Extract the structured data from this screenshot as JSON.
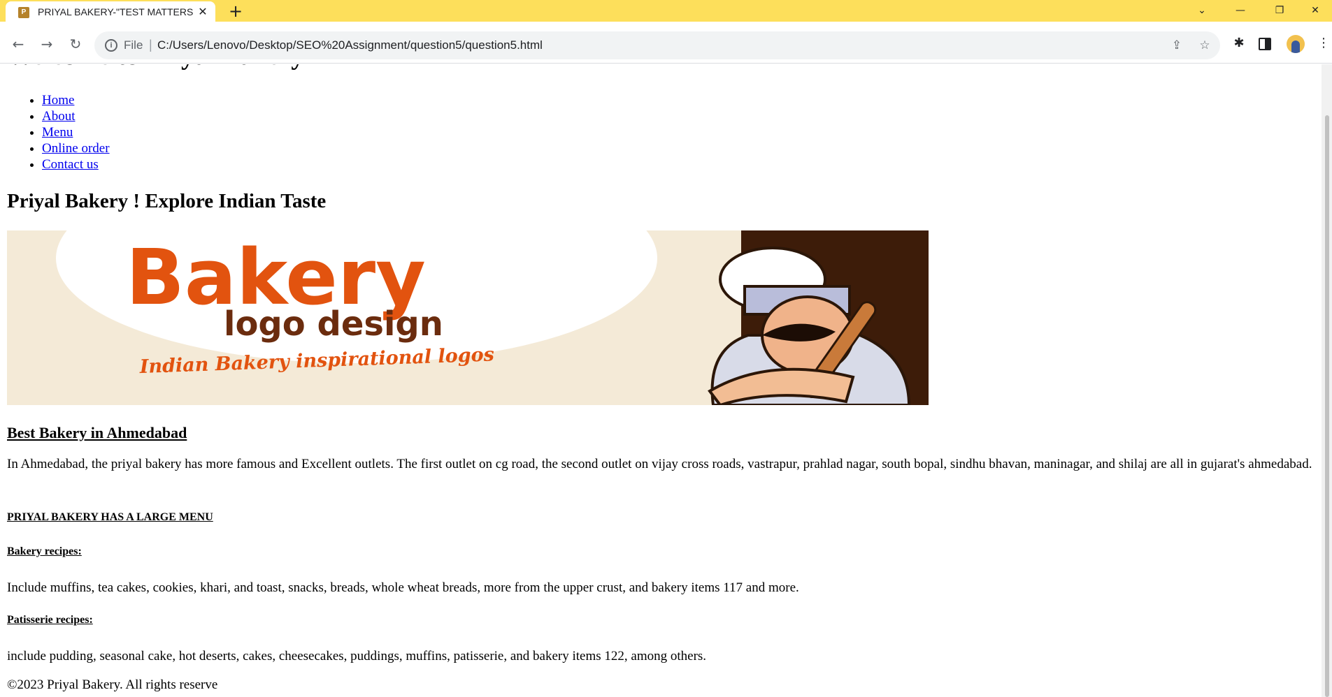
{
  "browser": {
    "tab_title": "PRIYAL BAKERY-\"TEST MATTERS",
    "tab_favicon_letter": "P",
    "url_scheme": "File",
    "url": "C:/Users/Lenovo/Desktop/SEO%20Assignment/question5/question5.html",
    "accent_color": "#fddf5b"
  },
  "page": {
    "title_cut": "Welcome to Priyal Bakery",
    "nav": [
      "Home",
      "About",
      "Menu",
      "Online order",
      "Contact us"
    ],
    "h2": "Priyal Bakery ! Explore Indian Taste",
    "banner": {
      "word": "Bakery",
      "subtitle": "logo design",
      "tagline": "Indian Bakery inspirational logos",
      "word_color": "#e2530f"
    },
    "h3": "Best Bakery in Ahmedabad",
    "intro": "In Ahmedabad, the priyal bakery has more famous and Excellent outlets. The first outlet on cg road, the second outlet on vijay cross roads, vastrapur, prahlad nagar, south bopal, sindhu bhavan, maninagar, and shilaj are all in gujarat's ahmedabad.",
    "menu_heading": "PRIYAL BAKERY HAS A LARGE MENU",
    "bakery_heading": "Bakery recipes:",
    "bakery_text": "Include muffins, tea cakes, cookies, khari, and toast, snacks, breads, whole wheat breads, more from the upper crust, and bakery items 117 and more.",
    "patisserie_heading": "Patisserie recipes:",
    "patisserie_text": "include pudding, seasonal cake, hot deserts, cakes, cheesecakes, puddings, muffins, patisserie, and bakery items 122, among others.",
    "footer": "©2023 Priyal Bakery. All rights reserve"
  }
}
